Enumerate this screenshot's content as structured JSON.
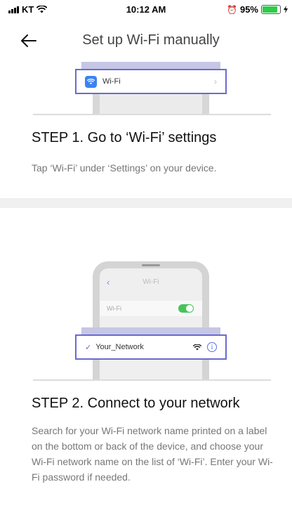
{
  "status_bar": {
    "carrier": "KT",
    "time": "10:12 AM",
    "battery": "95%",
    "battery_level": 0.95,
    "icons": [
      "signal-icon",
      "wifi-icon",
      "alarm-icon",
      "battery-icon",
      "charging-icon"
    ]
  },
  "header": {
    "back_icon": "back-arrow-icon",
    "title": "Set up Wi-Fi manually"
  },
  "step1": {
    "illustration": {
      "row_label": "Wi-Fi",
      "row_icon": "wifi-settings-icon",
      "chevron": "›"
    },
    "title": "STEP 1. Go to ‘Wi-Fi’ settings",
    "description": "Tap ‘Wi-Fi’ under ‘Settings’ on your device."
  },
  "step2": {
    "illustration": {
      "nav_back": "‹",
      "nav_title": "Wi-Fi",
      "wifi_row_label": "Wi-Fi",
      "wifi_toggle_on": true,
      "network_check": "✓",
      "network_name": "Your_Network",
      "info_symbol": "i"
    },
    "title": "STEP 2. Connect to your network",
    "description": "Search for your Wi-Fi network name printed on a label on the bottom or back of the device, and choose your Wi-Fi network name on the list of ‘Wi-Fi’. Enter your Wi-Fi password if needed."
  },
  "colors": {
    "highlight": "#6a6ad0",
    "highlight_fill": "#c6c6e6",
    "toggle_on": "#45c45b",
    "wifi_icon_bg": "#3b82f6",
    "battery_fill": "#2fcc4a"
  }
}
